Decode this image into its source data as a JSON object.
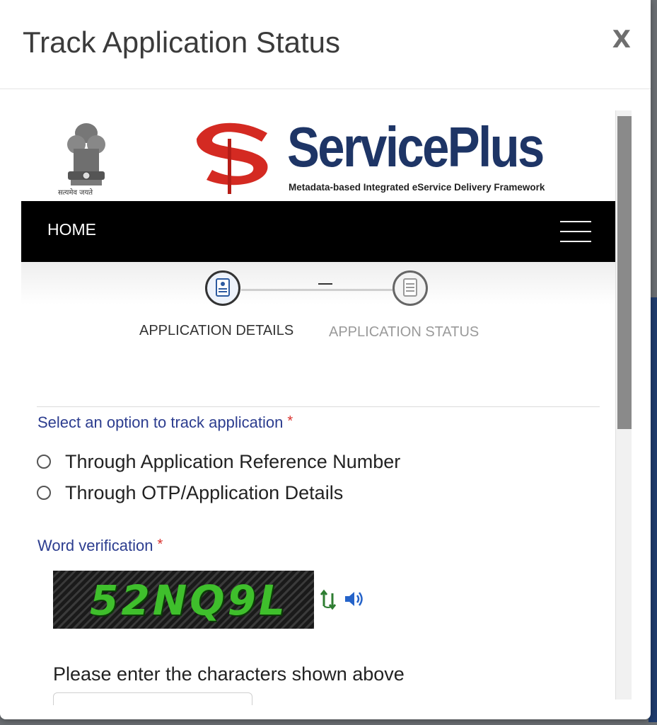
{
  "modal": {
    "title": "Track Application Status",
    "close_label": "X"
  },
  "banner": {
    "emblem_caption": "सत्यमेव जयते",
    "brand_name": "ServicePlus",
    "tagline": "Metadata-based Integrated eService Delivery Framework"
  },
  "nav": {
    "home_label": "HOME"
  },
  "stepper": {
    "steps": [
      {
        "label": "APPLICATION DETAILS",
        "state": "active"
      },
      {
        "label": "APPLICATION STATUS",
        "state": "inactive"
      }
    ]
  },
  "form": {
    "track_option_label": "Select an option to track application",
    "required_mark": "*",
    "options": [
      {
        "label": "Through Application Reference Number",
        "selected": false
      },
      {
        "label": "Through OTP/Application Details",
        "selected": false
      }
    ],
    "word_verification_label": "Word verification",
    "captcha_text": "52NQ9L",
    "instruction": "Please enter the characters shown above",
    "captcha_input_value": ""
  },
  "colors": {
    "brand_navy": "#1e3566",
    "brand_red": "#d42a22",
    "label_blue": "#2c3d8f",
    "required_red": "#d9302c",
    "captcha_green": "#3fbf2c"
  },
  "icons": [
    "national-emblem-icon",
    "serviceplus-logo-icon",
    "hamburger-menu-icon",
    "application-details-step-icon",
    "application-status-step-icon",
    "refresh-captcha-icon",
    "audio-captcha-icon"
  ]
}
